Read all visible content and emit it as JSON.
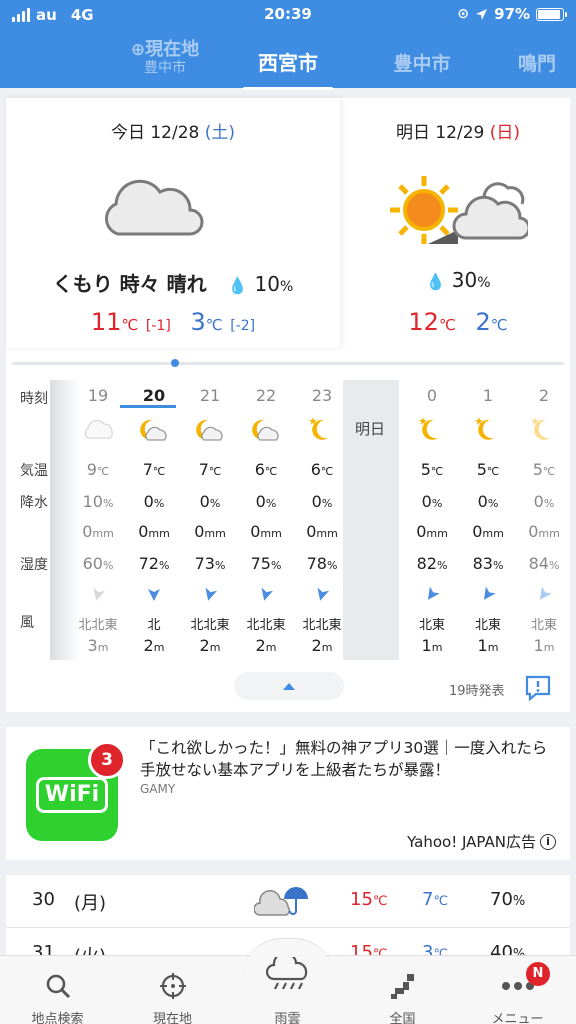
{
  "status": {
    "carrier": "au",
    "network": "4G",
    "time": "20:39",
    "battery": "97%"
  },
  "tabs": {
    "loc_main": "現在地",
    "loc_sub": "豊中市",
    "current": "西宮市",
    "t3": "豊中市",
    "t4": "鳴門"
  },
  "today": {
    "label": "今日 12/28 ",
    "dow": "(土)",
    "condition": "くもり 時々 晴れ",
    "rain": "10",
    "rain_unit": "%",
    "high": "11",
    "high_diff": "[-1]",
    "low": "3",
    "low_diff": "[-2]",
    "deg": "℃",
    "icon": "cloudy-then-moon"
  },
  "tomorrow": {
    "label": "明日 12/29 ",
    "dow": "(日)",
    "rain": "30",
    "rain_unit": "%",
    "high": "12",
    "low": "2",
    "deg": "℃",
    "icon": "sunny-then-cloudy"
  },
  "hourly": {
    "labels": {
      "time": "時刻",
      "temp": "気温",
      "precip": "降水",
      "humidity": "湿度",
      "wind": "風",
      "tomorrow": "明日"
    },
    "hours": [
      {
        "h": "19",
        "icon": "cloud",
        "temp": "9",
        "precip": "10",
        "mm": "0",
        "hum": "60",
        "dir": "北北東",
        "ws": "3",
        "past": true
      },
      {
        "h": "20",
        "icon": "moon-cloud",
        "temp": "7",
        "precip": "0",
        "mm": "0",
        "hum": "72",
        "dir": "北",
        "ws": "2",
        "now": true
      },
      {
        "h": "21",
        "icon": "moon-cloud",
        "temp": "7",
        "precip": "0",
        "mm": "0",
        "hum": "73",
        "dir": "北北東",
        "ws": "2"
      },
      {
        "h": "22",
        "icon": "moon-cloud",
        "temp": "6",
        "precip": "0",
        "mm": "0",
        "hum": "75",
        "dir": "北北東",
        "ws": "2"
      },
      {
        "h": "23",
        "icon": "moon-star",
        "temp": "6",
        "precip": "0",
        "mm": "0",
        "hum": "78",
        "dir": "北北東",
        "ws": "2"
      },
      {
        "h": "0",
        "icon": "moon-star",
        "temp": "5",
        "precip": "0",
        "mm": "0",
        "hum": "82",
        "dir": "北東",
        "ws": "1"
      },
      {
        "h": "1",
        "icon": "moon-star",
        "temp": "5",
        "precip": "0",
        "mm": "0",
        "hum": "83",
        "dir": "北東",
        "ws": "1"
      },
      {
        "h": "2",
        "icon": "moon-star",
        "temp": "5",
        "precip": "0",
        "mm": "0",
        "hum": "84",
        "dir": "北東",
        "ws": "1",
        "faded": true
      }
    ],
    "units": {
      "deg": "℃",
      "pct": "%",
      "mm": "mm",
      "m": "m"
    },
    "issued": "19時発表"
  },
  "ad": {
    "badge": "3",
    "logo_text": "WiFi",
    "text": "「これ欲しかった！」無料の神アプリ30選｜一度入れたら手放せない基本アプリを上級者たちが暴露！",
    "source": "GAMY",
    "sponsor": "Yahoo! JAPAN広告"
  },
  "weekly": [
    {
      "date": "30",
      "dow": "(月)",
      "icon": "cloud-umbrella",
      "high": "15",
      "low": "7",
      "rain": "70",
      "deg": "℃",
      "pct": "%"
    },
    {
      "date": "31",
      "dow": "(火)",
      "icon": "cloud",
      "high": "15",
      "low": "3",
      "rain": "40",
      "deg": "℃",
      "pct": "%"
    }
  ],
  "nav": [
    {
      "label": "地点検索",
      "icon": "search-icon"
    },
    {
      "label": "現在地",
      "icon": "crosshair-icon"
    },
    {
      "label": "雨雲",
      "icon": "rain-cloud-icon"
    },
    {
      "label": "全国",
      "icon": "japan-map-icon"
    },
    {
      "label": "メニュー",
      "icon": "more-icon",
      "badge": "N"
    }
  ],
  "colors": {
    "header": "#3f8ce3",
    "red": "#e0242b",
    "blue": "#3a74c9",
    "sun": "#f6b300",
    "ad_green": "#2ed12e"
  }
}
